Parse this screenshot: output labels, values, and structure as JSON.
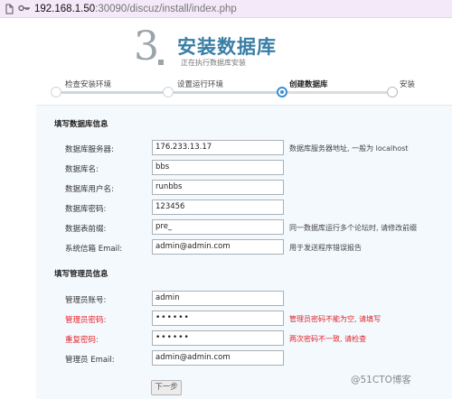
{
  "browser": {
    "url_host": "192.168.1.50",
    "url_rest": ":30090/discuz/install/index.php"
  },
  "header": {
    "step_number": "3",
    "title": "安装数据库",
    "subtitle": "正在执行数据库安装"
  },
  "steps": [
    {
      "label": "检查安装环境",
      "state": "done"
    },
    {
      "label": "设置运行环境",
      "state": "done"
    },
    {
      "label": "创建数据库",
      "state": "active"
    },
    {
      "label": "安装",
      "state": "todo"
    }
  ],
  "db_section": {
    "title": "填写数据库信息",
    "fields": [
      {
        "label": "数据库服务器:",
        "value": "176.233.13.17",
        "hint": "数据库服务器地址, 一般为 localhost",
        "error": false
      },
      {
        "label": "数据库名:",
        "value": "bbs",
        "hint": "",
        "error": false
      },
      {
        "label": "数据库用户名:",
        "value": "runbbs",
        "hint": "",
        "error": false
      },
      {
        "label": "数据库密码:",
        "value": "123456",
        "hint": "",
        "error": false
      },
      {
        "label": "数据表前缀:",
        "value": "pre_",
        "hint": "同一数据库运行多个论坛时, 请修改前缀",
        "error": false
      },
      {
        "label": "系统信箱 Email:",
        "value": "admin@admin.com",
        "hint": "用于发送程序错误报告",
        "error": false
      }
    ]
  },
  "admin_section": {
    "title": "填写管理员信息",
    "fields": [
      {
        "label": "管理员账号:",
        "value": "admin",
        "hint": "",
        "error": false
      },
      {
        "label": "管理员密码:",
        "value": "••••••",
        "hint": "管理员密码不能为空, 请填写",
        "error": true
      },
      {
        "label": "重复密码:",
        "value": "••••••",
        "hint": "两次密码不一致, 请检查",
        "error": true
      },
      {
        "label": "管理员 Email:",
        "value": "admin@admin.com",
        "hint": "",
        "error": false
      }
    ]
  },
  "next_button": "下一步",
  "watermark": "@51CTO博客"
}
